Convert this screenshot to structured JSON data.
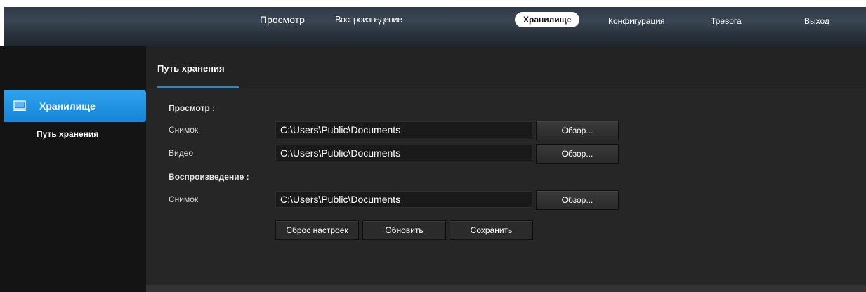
{
  "topbar": {
    "items": [
      {
        "label": "Просмотр"
      },
      {
        "label": "Воспроизведение"
      },
      {
        "label": "Хранилище",
        "active": true
      },
      {
        "label": "Конфигурация"
      },
      {
        "label": "Тревога"
      },
      {
        "label": "Выход"
      }
    ]
  },
  "sidebar": {
    "section_title": "Хранилище",
    "items": [
      {
        "label": "Путь хранения"
      }
    ],
    "icon": "monitor-icon"
  },
  "main": {
    "tab_title": "Путь хранения",
    "preview_section": "Просмотр :",
    "playback_section": "Воспроизведение :",
    "rows": [
      {
        "label": "Снимок",
        "value": "C:\\Users\\Public\\Documents",
        "button": "Обзор..."
      },
      {
        "label": "Видео",
        "value": "C:\\Users\\Public\\Documents",
        "button": "Обзор..."
      },
      {
        "label": "Снимок",
        "value": "C:\\Users\\Public\\Documents",
        "button": "Обзор..."
      }
    ],
    "buttons": {
      "reset": "Сброс настроек",
      "refresh": "Обновить",
      "save": "Сохранить"
    }
  },
  "colors": {
    "accent": "#1c8de0",
    "sidebar_bg": "#141414",
    "panel_bg": "#262626"
  }
}
